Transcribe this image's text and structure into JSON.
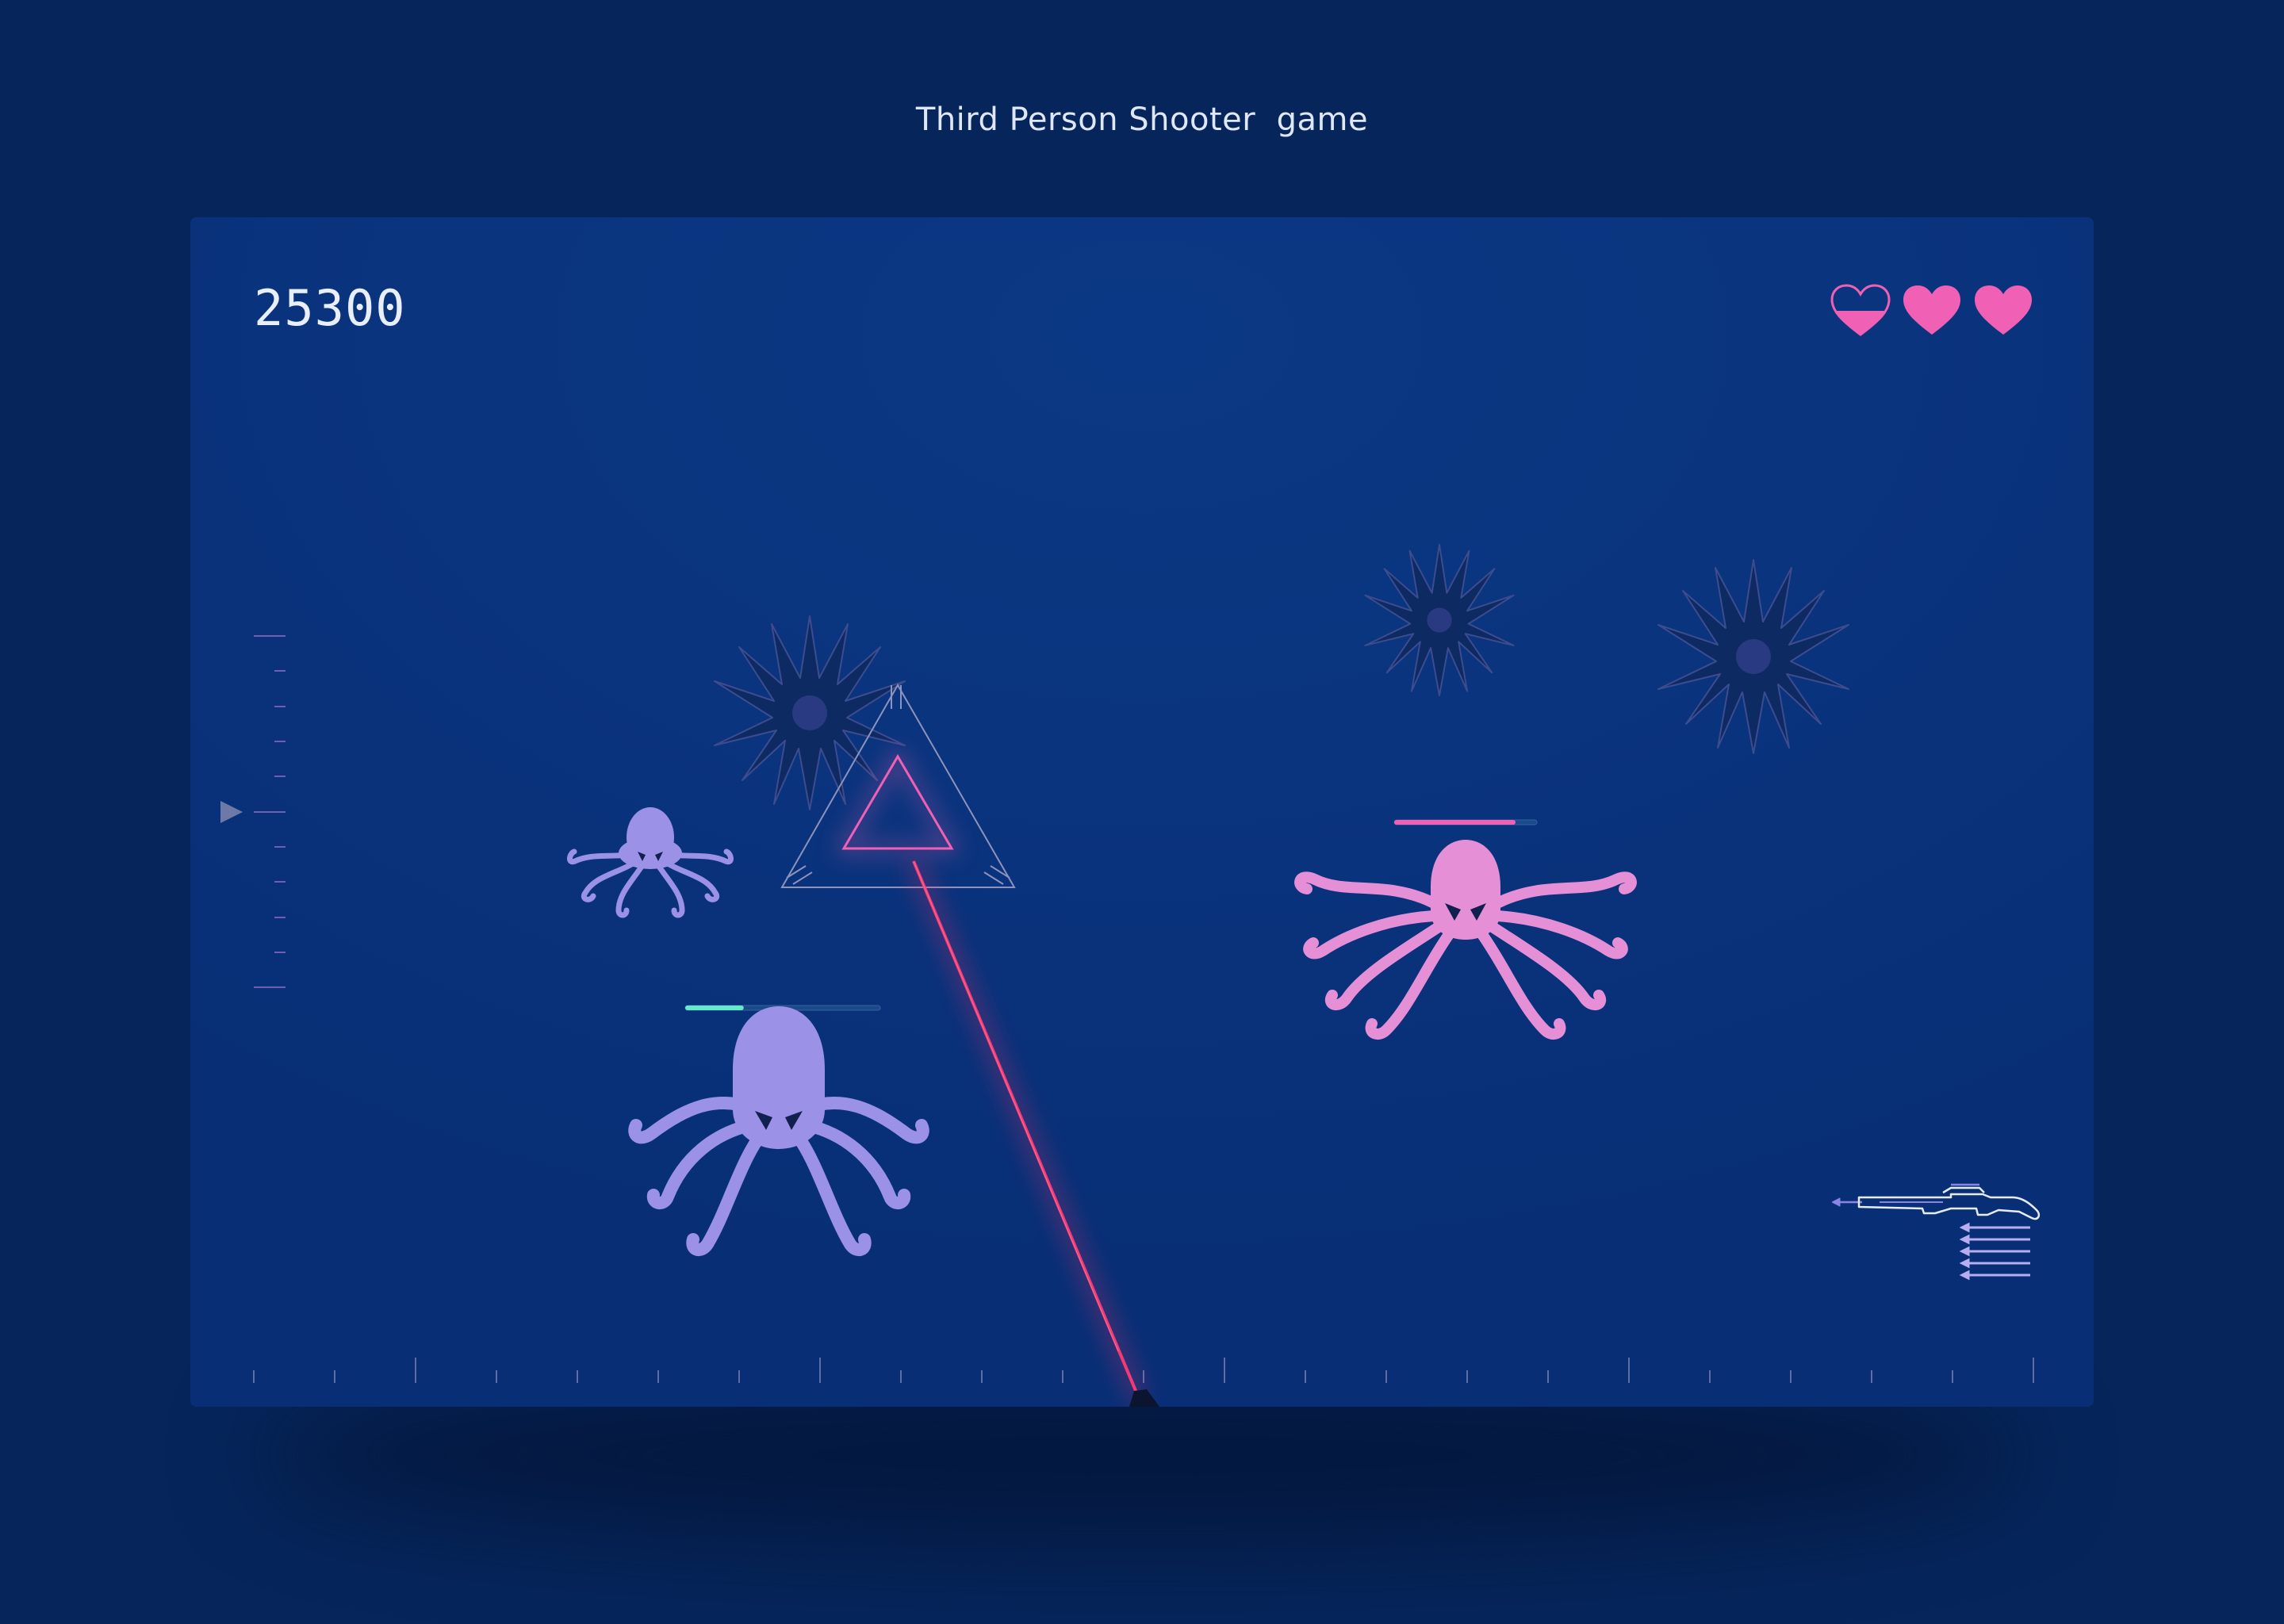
{
  "page": {
    "title": "Third Person Shooter  game"
  },
  "hud": {
    "score": "25300",
    "lives": [
      {
        "icon": "heart-icon",
        "fill": 0.5
      },
      {
        "icon": "heart-icon",
        "fill": 1
      },
      {
        "icon": "heart-icon",
        "fill": 1
      }
    ]
  },
  "enemies": {
    "large_purple_octopus": {
      "color": "#9b91e6",
      "health": 0.3
    },
    "pink_octopus": {
      "color": "#e58fd6",
      "health": 0.85
    },
    "small_purple_octopus": {
      "color": "#9b91e6"
    }
  },
  "weapon": {
    "icon": "rifle-icon",
    "ammo": 5
  },
  "colors": {
    "background": "#06255a",
    "board": "#082f76",
    "heart": "#f060b4",
    "laser": "#ff2d6a",
    "health_green": "#66e8cc",
    "health_pink": "#f060b4",
    "mine": "#0d2558"
  }
}
